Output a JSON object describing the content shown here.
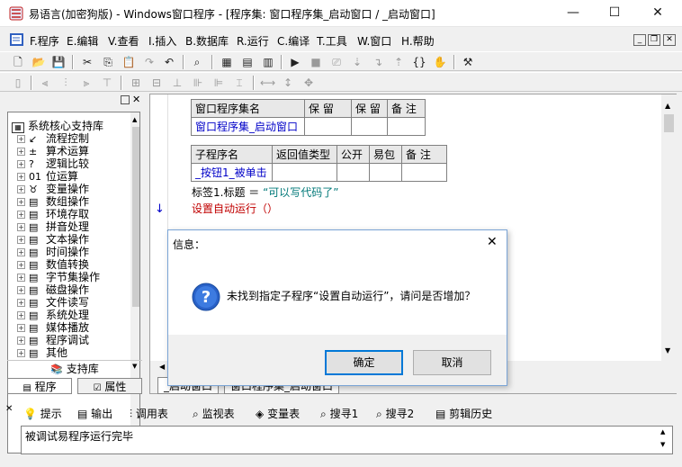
{
  "window": {
    "title": "易语言(加密狗版) - Windows窗口程序 - [程序集: 窗口程序集_启动窗口 / _启动窗口]",
    "minimize": "—",
    "maximize": "☐",
    "close": "✕"
  },
  "menu": {
    "items": [
      "F.程序",
      "E.编辑",
      "V.查看",
      "I.插入",
      "B.数据库",
      "R.运行",
      "C.编译",
      "T.工具",
      "W.窗口",
      "H.帮助"
    ],
    "mdi_minimize": "_",
    "mdi_restore": "❐",
    "mdi_close": "✕"
  },
  "left_panel": {
    "close": "✕",
    "tree_root": "系统核心支持库",
    "tree_items": [
      "流程控制",
      "算术运算",
      "逻辑比较",
      "位运算",
      "变量操作",
      "数组操作",
      "环境存取",
      "拼音处理",
      "文本操作",
      "时间操作",
      "数值转换",
      "字节集操作",
      "磁盘操作",
      "文件读写",
      "系统处理",
      "媒体播放",
      "程序调试",
      "其他"
    ],
    "tree_icons": [
      "arrow-icon",
      "math-icon",
      "question-icon",
      "bits-icon",
      "variable-icon",
      "doc-icon",
      "doc-icon",
      "doc-icon",
      "doc-icon",
      "doc-icon",
      "doc-icon",
      "doc-icon",
      "doc-icon",
      "doc-icon",
      "doc-icon",
      "doc-icon",
      "doc-icon",
      "doc-icon"
    ],
    "support_lib_label": "支持库",
    "tabs": [
      "程序",
      "属性"
    ]
  },
  "editor": {
    "assembly_table": {
      "headers": [
        "窗口程序集名",
        "保 留",
        "保 留",
        "备 注"
      ],
      "row": [
        "窗口程序集_启动窗口",
        "",
        "",
        ""
      ]
    },
    "sub_table": {
      "headers": [
        "子程序名",
        "返回值类型",
        "公开",
        "易包",
        "备 注"
      ],
      "row": [
        "_按钮1_被单击",
        "",
        "",
        "",
        ""
      ]
    },
    "code_line1_prefix": "标签1.标题 ＝ ",
    "code_line1_string": "“可以写代码了”",
    "code_line2": "设置自动运行（）",
    "tabs": [
      "_启动窗口",
      "窗口程序集_启动窗口"
    ]
  },
  "bottom": {
    "tabs": [
      "提示",
      "输出",
      "调用表",
      "监视表",
      "变量表",
      "搜寻1",
      "搜寻2",
      "剪辑历史"
    ],
    "output_text": "被调试易程序运行完毕"
  },
  "dialog": {
    "title": "信息：",
    "message": "未找到指定子程序“设置自动运行”，请问是否增加？",
    "ok": "确定",
    "cancel": "取消",
    "close": "✕"
  },
  "colors": {
    "accent_blue": "#0000c8",
    "dialog_border": "#7aa4d6",
    "default_button_border": "#0078d7",
    "code_red": "#c00000",
    "code_green": "#007878"
  }
}
